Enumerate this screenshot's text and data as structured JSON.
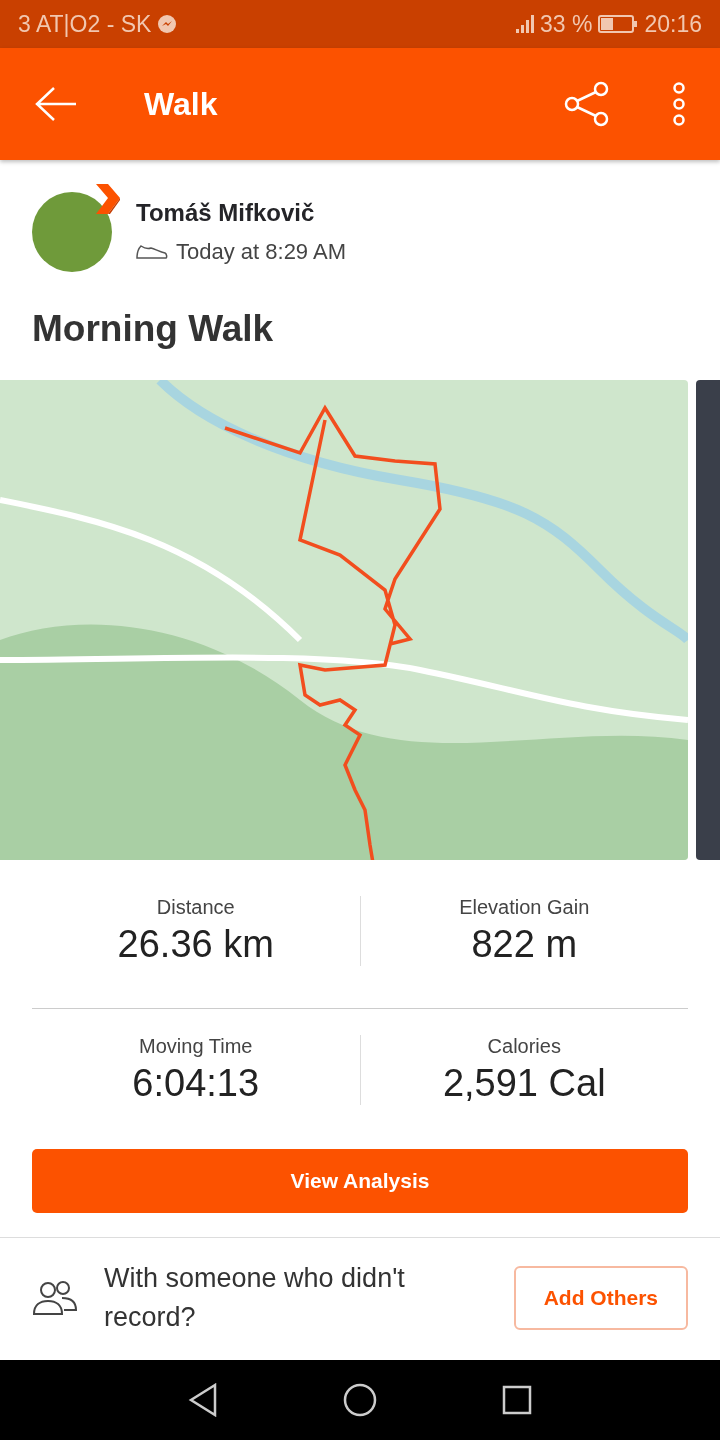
{
  "status_bar": {
    "carrier": "3 AT|O2 - SK",
    "battery": "33 %",
    "time": "20:16"
  },
  "app_bar": {
    "title": "Walk"
  },
  "athlete": {
    "name": "Tomáš Mifkovič",
    "time": "Today at 8:29 AM"
  },
  "activity": {
    "title": "Morning Walk"
  },
  "stats": [
    {
      "label": "Distance",
      "value": "26.36 km"
    },
    {
      "label": "Elevation Gain",
      "value": "822 m"
    },
    {
      "label": "Moving Time",
      "value": "6:04:13"
    },
    {
      "label": "Calories",
      "value": "2,591 Cal"
    }
  ],
  "analysis_button": "View Analysis",
  "prompt": {
    "text": "With someone who didn't record?",
    "button": "Add Others"
  }
}
